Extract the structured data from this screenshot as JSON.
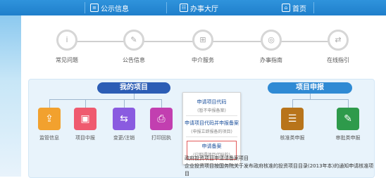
{
  "nav": {
    "home": "首页",
    "service_hall": "办事大厅",
    "public_info": "公示信息"
  },
  "steps": [
    {
      "label": "在线指引",
      "icon": "⇄"
    },
    {
      "label": "办事指南",
      "icon": "◎"
    },
    {
      "label": "中介服务",
      "icon": "⊞"
    },
    {
      "label": "公告信息",
      "icon": "✎"
    },
    {
      "label": "常见问题",
      "icon": "i"
    }
  ],
  "sections": {
    "left_title": "我的项目",
    "right_title": "项目申报"
  },
  "apps": [
    {
      "name": "监管信息",
      "color": "#f2a12e",
      "icon": "⇪"
    },
    {
      "name": "项目中报",
      "color": "#ef5a6f",
      "icon": "▣"
    },
    {
      "name": "变更/注销",
      "color": "#8a5be0",
      "icon": "⇆"
    },
    {
      "name": "打印回执",
      "color": "#c23fb0",
      "icon": "⎙"
    },
    {
      "name": "核准类申报",
      "color": "#b8741b",
      "icon": "☰"
    },
    {
      "name": "审批类申报",
      "color": "#2e9a4b",
      "icon": "✎"
    }
  ],
  "dropdown": [
    {
      "title": "申请项目代码",
      "sub": "(暂不申报备案)"
    },
    {
      "title": "申请项目代码并申报备案",
      "sub": "(申报立即报备的项目)"
    },
    {
      "title": "申请备案",
      "sub": "(已取得项目代码的)"
    }
  ],
  "notes": [
    "政府投资项目申请请备案项目",
    "企业投资项目按国务院关于发布政府核准的投资项目目录(2013年本)的通知申请核准项目"
  ]
}
